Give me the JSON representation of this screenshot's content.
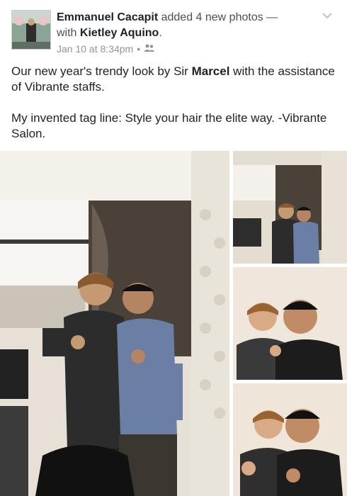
{
  "post": {
    "author": "Emmanuel Cacapit",
    "action": " added 4 new photos —",
    "with_prefix": "with ",
    "tagged": "Kietley Aquino",
    "tagged_suffix": ".",
    "timestamp": "Jan 10 at 8:34pm",
    "separator": "•",
    "audience_icon": "friends-icon",
    "menu_icon": "chevron-down-icon",
    "text_line1_a": "Our new year's trendy look by Sir ",
    "text_line1_bold": "Marcel",
    "text_line1_b": " with the assistance of Vibrante staffs.",
    "text_para2": "My invented tag line: Style your hair the elite way. -Vibrante Salon."
  },
  "photos": [
    {
      "name": "photo-1",
      "description_icon": "photo-two-men-salon"
    },
    {
      "name": "photo-2",
      "description_icon": "photo-two-men-curtain"
    },
    {
      "name": "photo-3",
      "description_icon": "photo-two-men-thumbs"
    },
    {
      "name": "photo-4",
      "description_icon": "photo-two-men-hands"
    }
  ],
  "colors": {
    "text": "#1d2129",
    "meta": "#90949c",
    "link": "#4b4f56"
  }
}
